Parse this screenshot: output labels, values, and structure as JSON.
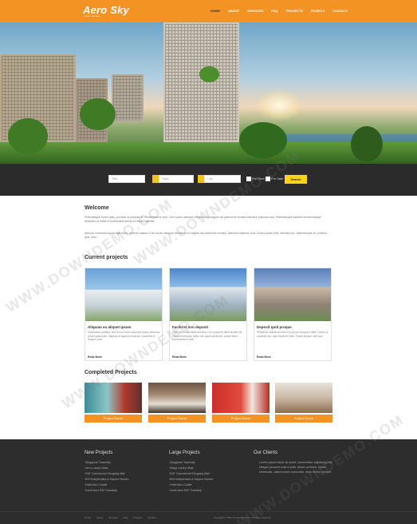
{
  "header": {
    "logo": "Aero Sky",
    "logo_sub": "real estate",
    "nav": [
      {
        "label": "HOME",
        "active": true
      },
      {
        "label": "ABOUT"
      },
      {
        "label": "SERVICES"
      },
      {
        "label": "FAQ"
      },
      {
        "label": "PROJECTS"
      },
      {
        "label": "PAGES ▾"
      },
      {
        "label": "CONTACT"
      }
    ]
  },
  "search": {
    "field1_placeholder": "Title",
    "field2_placeholder": "Type",
    "field3_placeholder": "City",
    "check1_label": "For Rent",
    "check2_label": "For Sale",
    "button": "Search"
  },
  "welcome": {
    "title": "Welcome",
    "para1": "Pellentesque lorem justo, pulvinar et pulvinar id, elementum et velit. Cum sociis natoque penatibus et magnis dis parturient montes nascetur ridiculus mus. Pellentesque habitant morbi tristique senectus et netus et malesuada fames ac turpis egestas.",
    "para2": "Aenean commodo ligula eget dolor. Aenean massa. Cum sociis natoque penatibus et magnis dis parturient montes, nascetur ridiculus mus. Donec quam felis, ultricies nec, pellentesque eu, pretium quis, sem."
  },
  "current": {
    "title": "Current projects",
    "items": [
      {
        "name": "Aliquam eu aliquet ipsum",
        "desc": "Vestibulum porttitor, sed non ut tortor euismod ipsum vehicula, porta ligula nulla. Aliquam at ligula eu mauris. Curabitur ut tempor urna.",
        "more": "Read More"
      },
      {
        "name": "Faclerisl non deposit",
        "desc": "Cras venenatis eleifend lorem, non posuere diam lacinia vel. Vivamus tempus, tellus nec placerat dictum, quam libero condimentum velit.",
        "more": "Read More"
      },
      {
        "name": "Deposit quid proque",
        "desc": "Phasellus sollicitudin tortor eu ipsum tempus mollis. Donec ut molestie nisi, quis hendrerit nibh. Fusce tempor nibh sed.",
        "more": "Read More"
      }
    ]
  },
  "completed": {
    "title": "Completed Projects",
    "items": [
      {
        "button": "Project Name"
      },
      {
        "button": "Project Name"
      },
      {
        "button": "Project Name"
      },
      {
        "button": "Project Name"
      }
    ]
  },
  "footer": {
    "col1_title": "New Projects",
    "col1_items": [
      "Singapore Township",
      "Aero Luxury Villas",
      "RAT Commercial Shopping Mall",
      "BHI Independent & Kapoor Homes",
      "Hotel Aero Castle",
      "North Aero RAT Township"
    ],
    "col2_title": "Large Projects",
    "col2_items": [
      "Singapore Township",
      "Mega Luxury Villas",
      "RAT Commercial Shopping Mall",
      "BHI Independent & Kapoor Homes",
      "Hotel Aero Castle",
      "North Aero RAT Township"
    ],
    "col3_title": "Our Clients",
    "quote": "Lorem ipsum dolor sit amet, consectetur adipiscing elit. Integer posuere erat a ante, donec pretium. Etiam venenatis, ullamcorper commodo, enim lorem semper.",
    "bottom_links": [
      "Home",
      "About",
      "Services",
      "FAQ",
      "Projects",
      "Contact"
    ],
    "copyright": "Copyright © 2014 Company Name. All rights reserved."
  },
  "watermark": "WWW.DOWNDEMO.COM",
  "colors": {
    "accent": "#f39323",
    "search_button": "#f7d418",
    "footer": "#2d2d2d"
  }
}
